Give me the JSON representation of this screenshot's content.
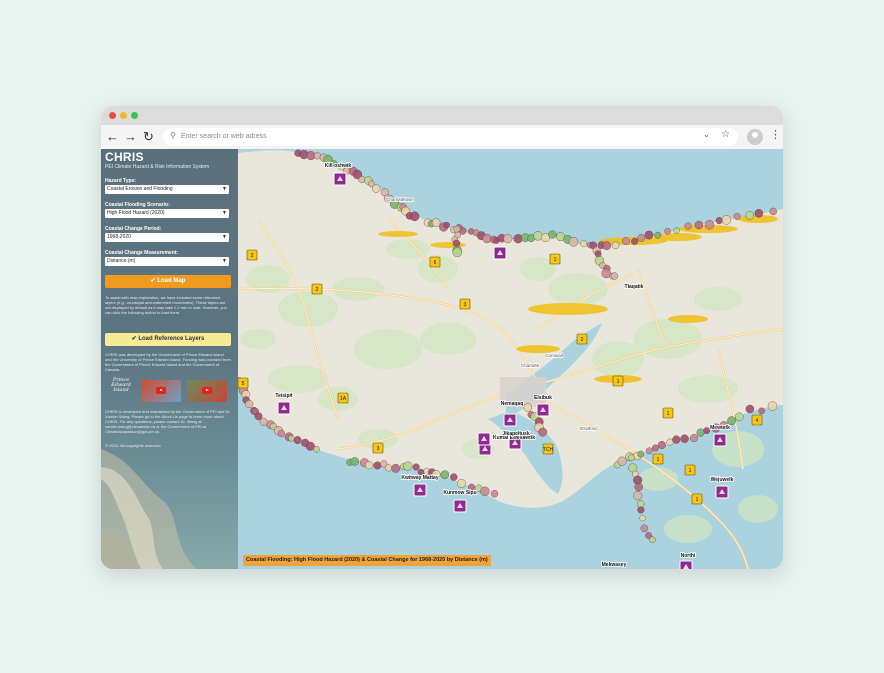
{
  "browser": {
    "url_placeholder": "Enter search or web adress",
    "back_icon": "arrow-left-icon",
    "forward_icon": "arrow-right-icon",
    "reload_icon": "reload-icon"
  },
  "sidebar": {
    "title": "CHRIS",
    "subtitle": "PEI Climate Hazard & Risk Information System",
    "hazard_type": {
      "label": "Hazard Type:",
      "value": "Coastal Erosion and Flooding"
    },
    "flood_scenario": {
      "label": "Coastal Flooding Scenario:",
      "value": "High Flood Hazard (2020)"
    },
    "change_period": {
      "label": "Coastal Change Period:",
      "value": "1968-2020"
    },
    "measurement": {
      "label": "Coastal Change Measurement:",
      "value": "Distance (m)"
    },
    "load_map_label": "Load Map",
    "reference_text": "To assist with map exploration, we have included some reference layers (e.g., municipal and watershed boundaries). These layers are not displayed by default as it may take 1-2 min to load. However, you can click the following button to load them.",
    "load_reference_label": "Load Reference Layers",
    "funding_text": "CHRIS was developed by the Government of Prince Edward Island and the University of Prince Edward Island. Funding was provided from the Government of Prince Edward Island and the Government of Canada.",
    "pei_logo_text": "Prince Edward Island",
    "maintenance_text": "CHRIS is developed and maintained by the Government of PEI and Dr. Xander Wang. Please go to the About Us page to learn more about CHRIS. For any questions, please contact Dr. Wang at xander.wang@climatelab.ca or the Government of PEI at ClimateAdaptation@gov.pe.ca.",
    "copyright": "© 2024. All copyrights reserved."
  },
  "map": {
    "caption": "Coastal Flooding: High Flood Hazard (2020) & Coastal Change for 1968-2020 by Distance (m)",
    "places": [
      "Kill-oshwik",
      "Tlaqatik",
      "Teisipit",
      "Nemaqaq",
      "Elsibuk",
      "Kumal Ewesawtik",
      "Jikapeltusk",
      "Kwitway Mattay",
      "Kunmow Sipu",
      "Mewtetk",
      "Wejuwelk",
      "Mekwasey",
      "Northi",
      "Charlottetown",
      "Charlotte",
      "Cornwall",
      "Stratford"
    ],
    "road_labels": [
      "2",
      "2",
      "6",
      "3",
      "1",
      "2",
      "1",
      "1",
      "4",
      "1",
      "5",
      "3",
      "1A",
      "1",
      "1",
      "TCH"
    ],
    "colors": {
      "water": "#aad3df",
      "land": "#e9e6dc",
      "erosion": "#a0506a",
      "flood": "#f0c020",
      "marker": "#8e2b8e"
    }
  }
}
